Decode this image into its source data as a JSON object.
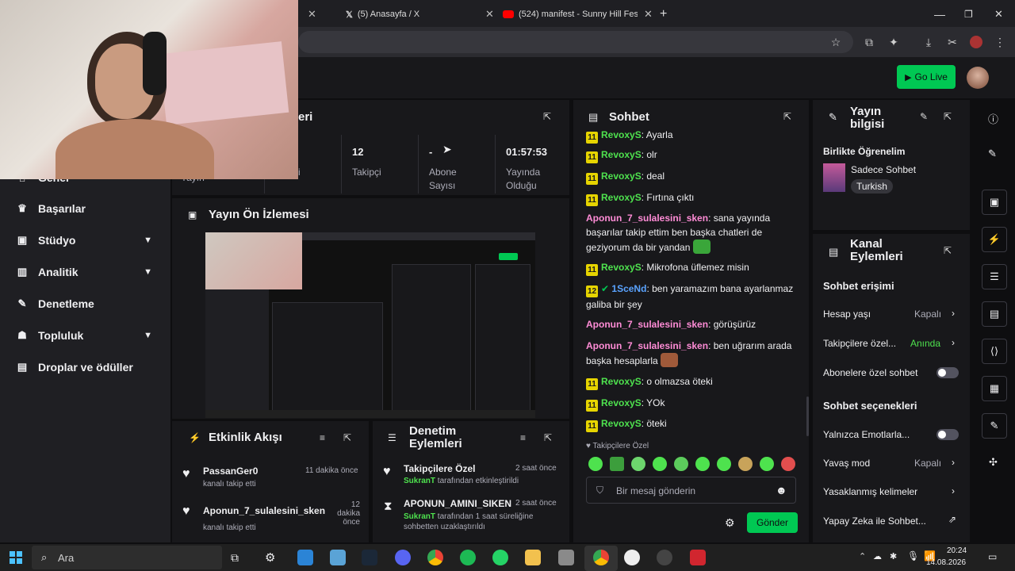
{
  "browser": {
    "tabs": [
      {
        "label": ""
      },
      {
        "label": "(5) Anasayfa / X"
      },
      {
        "label": "(524) manifest - Sunny Hill Festi"
      }
    ],
    "new_tab": "+"
  },
  "header": {
    "go_live": "Go Live"
  },
  "sidebar": {
    "items": [
      {
        "label": "Genel"
      },
      {
        "label": "Başarılar"
      },
      {
        "label": "Stüdyo"
      },
      {
        "label": "Analitik"
      },
      {
        "label": "Denetleme"
      },
      {
        "label": "Topluluk"
      },
      {
        "label": "Droplar ve ödüller"
      }
    ]
  },
  "stats": {
    "title_partial": "eri",
    "partial_left": "ci",
    "partial_far_left": "Yayın",
    "items": [
      {
        "value": "12",
        "label": "Takipçi"
      },
      {
        "value": "-",
        "label": "Abone Sayısı"
      },
      {
        "value": "01:57:53",
        "label": "Yayında Olduğu"
      }
    ]
  },
  "preview": {
    "title": "Yayın Ön İzlemesi"
  },
  "activity": {
    "title": "Etkinlik Akışı",
    "items": [
      {
        "user": "PassanGer0",
        "desc": "kanalı takip etti",
        "time": "11 dakika önce"
      },
      {
        "user": "Aponun_7_sulalesini_sken",
        "desc": "kanalı takip etti",
        "time": "12 dakika önce"
      }
    ]
  },
  "moderation": {
    "title": "Denetim Eylemleri",
    "items": [
      {
        "title": "Takipçilere Özel",
        "actor": "SukranT",
        "desc": "tarafından etkinleştirildi",
        "time": "2 saat önce"
      },
      {
        "title": "APONUN_AMINI_SIKEN",
        "actor": "SukranT",
        "desc": "tarafından 1 saat süreliğine sohbetten uzaklaştırıldı",
        "time": "2 saat önce"
      }
    ]
  },
  "chat": {
    "title": "Sohbet",
    "messages": [
      {
        "badge": "11",
        "user": "RevoxyS",
        "text": "Ayarla"
      },
      {
        "badge": "11",
        "user": "RevoxyS",
        "text": "olr"
      },
      {
        "badge": "11",
        "user": "RevoxyS",
        "text": "deal"
      },
      {
        "badge": "11",
        "user": "RevoxyS",
        "text": "Fırtına çıktı"
      },
      {
        "badge": "",
        "user": "Aponun_7_sulalesini_sken",
        "text": "sana yayında başarılar takip ettim ben başka chatleri de geziyorum da bir yandan"
      },
      {
        "badge": "11",
        "user": "RevoxyS",
        "text": "Mikrofona üflemez misin"
      },
      {
        "badge": "12",
        "user": "1SceNd",
        "text": "ben yaramazım bana ayarlanmaz galiba bir şey"
      },
      {
        "badge": "",
        "user": "Aponun_7_sulalesini_sken",
        "text": "görüşürüz"
      },
      {
        "badge": "",
        "user": "Aponun_7_sulalesini_sken",
        "text": "ben uğrarım arada başka hesaplarla"
      },
      {
        "badge": "11",
        "user": "RevoxyS",
        "text": "o olmazsa öteki"
      },
      {
        "badge": "11",
        "user": "RevoxyS",
        "text": "YOk"
      },
      {
        "badge": "11",
        "user": "RevoxyS",
        "text": "öteki"
      }
    ],
    "followers_only": "Takipçilere Özel",
    "input_placeholder": "Bir mesaj gönderin",
    "send": "Gönder"
  },
  "stream_info": {
    "title": "Yayın bilgisi",
    "stream_title": "Birlikte Öğrenelim",
    "category": "Sadece Sohbet",
    "tag": "Turkish"
  },
  "channel_actions": {
    "title": "Kanal Eylemleri",
    "section1": "Sohbet erişimi",
    "rows1": [
      {
        "label": "Hesap yaşı",
        "value": "Kapalı"
      },
      {
        "label": "Takipçilere özel...",
        "value": "Anında"
      },
      {
        "label": "Abonelere özel sohbet",
        "value": ""
      }
    ],
    "section2": "Sohbet seçenekleri",
    "rows2": [
      {
        "label": "Yalnızca Emotlarla...",
        "value": ""
      },
      {
        "label": "Yavaş mod",
        "value": "Kapalı"
      },
      {
        "label": "Yasaklanmış kelimeler",
        "value": ""
      },
      {
        "label": "Yapay Zeka ile Sohbet...",
        "value": ""
      }
    ]
  },
  "taskbar": {
    "search": "Ara",
    "time": "20:24",
    "date": "14.08.2026"
  },
  "colors": {
    "accent_green": "#00c853",
    "badge_yellow": "#e6d400"
  }
}
